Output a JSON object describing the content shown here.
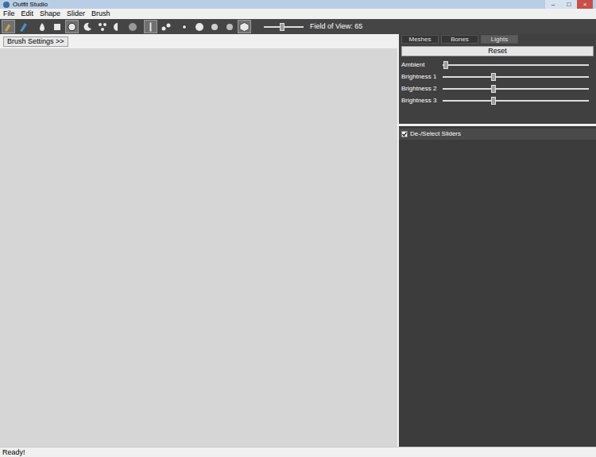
{
  "window": {
    "title": "Outfit Studio",
    "controls": [
      "–",
      "□",
      "×"
    ]
  },
  "menu": [
    "File",
    "Edit",
    "Shape",
    "Slider",
    "Brush"
  ],
  "toolbar": {
    "tools": [
      {
        "selected": true
      },
      {
        "selected": false
      },
      {
        "selected": false
      },
      {
        "selected": false
      },
      {
        "selected": true
      },
      {
        "selected": false
      },
      {
        "selected": false
      },
      {
        "selected": false
      },
      {
        "selected": false
      },
      {
        "selected": true
      },
      {
        "selected": false
      },
      {
        "selected": false
      },
      {
        "selected": false
      },
      {
        "selected": false
      },
      {
        "selected": false
      },
      {
        "selected": true
      }
    ],
    "fov": {
      "label": "Field of View: 65",
      "level": 0.45
    }
  },
  "brush_settings": {
    "label": "Brush Settings >>"
  },
  "panel": {
    "tabs": [
      {
        "label": "Meshes",
        "selected": false
      },
      {
        "label": "Bones",
        "selected": false
      },
      {
        "label": "Lights",
        "selected": true
      }
    ],
    "reset": "Reset",
    "lights": [
      {
        "label": "Ambient",
        "level": 0.02
      },
      {
        "label": "Brightness 1",
        "level": 0.35
      },
      {
        "label": "Brightness 2",
        "level": 0.35
      },
      {
        "label": "Brightness 3",
        "level": 0.35
      }
    ],
    "sliders_header": {
      "label": "De-/Select Sliders",
      "checked": true
    }
  },
  "status_bar": {
    "text": "Ready!"
  }
}
